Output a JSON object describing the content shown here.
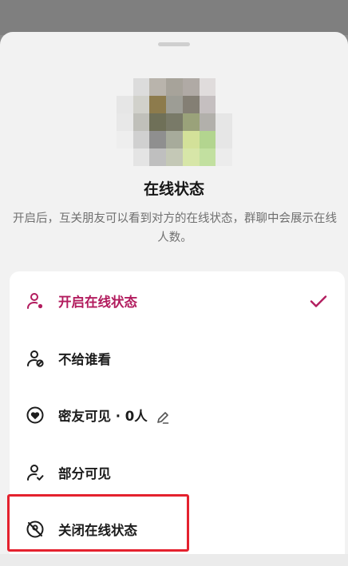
{
  "sheet": {
    "title": "在线状态",
    "description": "开启后，互关朋友可以看到对方的在线状态，群聊中会展示在线人数。"
  },
  "options": [
    {
      "label": "开启在线状态",
      "icon": "user-online-icon",
      "selected": true
    },
    {
      "label": "不给谁看",
      "icon": "user-blocked-icon",
      "selected": false
    },
    {
      "label": "密友可见 · 0人",
      "icon": "heart-circle-icon",
      "selected": false
    },
    {
      "label": "部分可见",
      "icon": "user-check-icon",
      "selected": false
    },
    {
      "label": "关闭在线状态",
      "icon": "offline-icon",
      "selected": false
    }
  ],
  "colors": {
    "accent": "#b21c5e",
    "highlight_box": "#e4212e"
  }
}
